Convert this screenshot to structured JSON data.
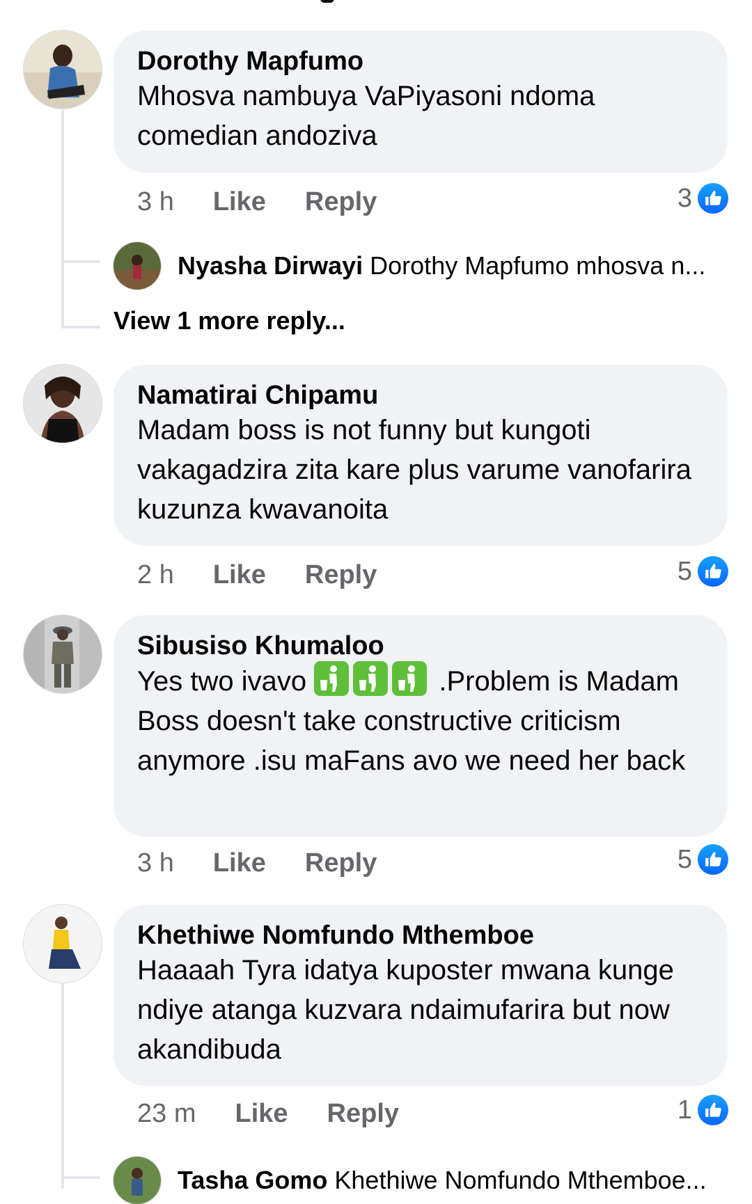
{
  "comments": [
    {
      "author": "Dorothy Mapfumo",
      "text": "Mhosva nambuya VaPiyasoni ndoma comedian andoziva",
      "time": "3 h",
      "like_label": "Like",
      "reply_label": "Reply",
      "like_count": "3",
      "reply_preview": {
        "author": "Nyasha Dirwayi",
        "snippet": "Dorothy Mapfumo mhosva n..."
      },
      "view_more": "View 1 more reply..."
    },
    {
      "author": "Namatirai Chipamu",
      "text": "Madam boss is not funny but kungoti vakagadzira zita kare plus varume vanofarira kuzunza kwavanoita",
      "time": "2 h",
      "like_label": "Like",
      "reply_label": "Reply",
      "like_count": "5"
    },
    {
      "author": "Sibusiso Khumaloo",
      "text_before_emoji": "Yes two ivavo",
      "emoji_name": "put-litter-in-its-place",
      "text_after_emoji": ".Problem is Madam Boss doesn't take constructive criticism anymore .isu maFans avo we need her back",
      "time": "3 h",
      "like_label": "Like",
      "reply_label": "Reply",
      "like_count": "5"
    },
    {
      "author": "Khethiwe Nomfundo Mthemboe",
      "text": "Haaaah Tyra idatya kuposter mwana kunge ndiye atanga kuzvara ndaimufarira but now akandibuda",
      "time": "23 m",
      "like_label": "Like",
      "reply_label": "Reply",
      "like_count": "1",
      "reply_preview": {
        "author": "Tasha Gomo",
        "snippet": "Khethiwe Nomfundo Mthemboe..."
      }
    }
  ],
  "colors": {
    "bubble": "#f0f2f5",
    "meta_text": "#65676b",
    "like_blue": "#0866ff",
    "thread_line": "#e4e6eb"
  }
}
